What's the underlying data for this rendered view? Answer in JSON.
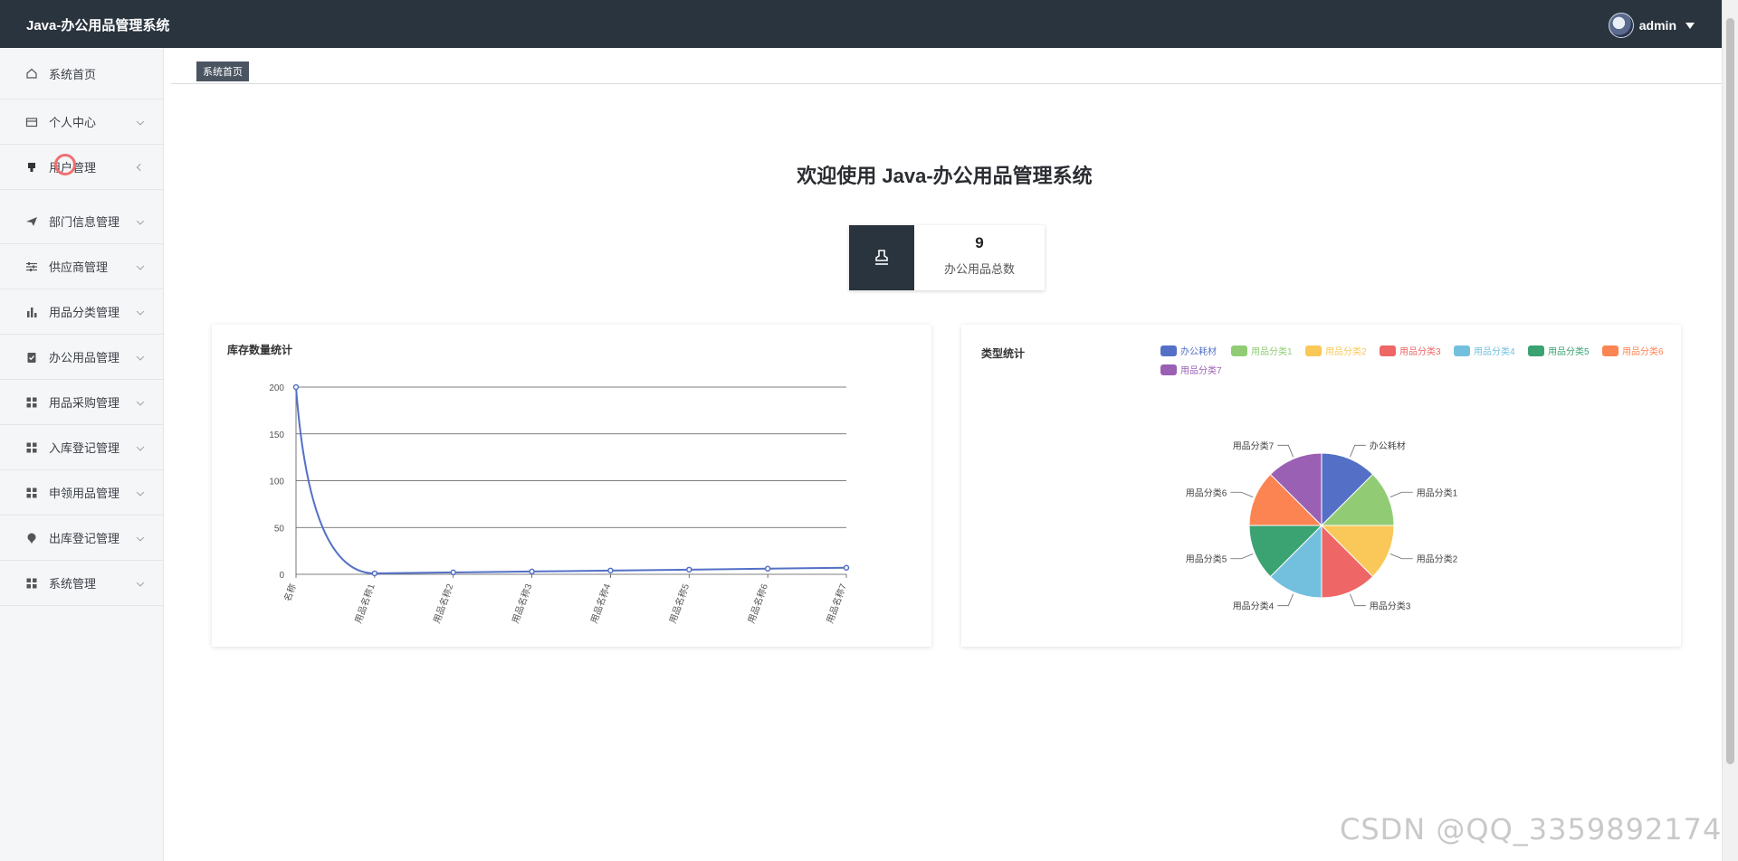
{
  "header": {
    "brand": "Java-办公用品管理系统",
    "username": "admin"
  },
  "sidebar": {
    "items": [
      {
        "label": "系统首页",
        "icon": "home-icon",
        "arrow": "none"
      },
      {
        "label": "个人中心",
        "icon": "card-icon",
        "arrow": "down"
      },
      {
        "label": "用户管理",
        "icon": "user-icon",
        "arrow": "left"
      },
      {
        "label": "部门信息管理",
        "icon": "send-icon",
        "arrow": "down"
      },
      {
        "label": "供应商管理",
        "icon": "sliders-icon",
        "arrow": "down"
      },
      {
        "label": "用品分类管理",
        "icon": "bar-chart-icon",
        "arrow": "down"
      },
      {
        "label": "办公用品管理",
        "icon": "clipboard-check-icon",
        "arrow": "down"
      },
      {
        "label": "用品采购管理",
        "icon": "grid-icon",
        "arrow": "down"
      },
      {
        "label": "入库登记管理",
        "icon": "grid-icon",
        "arrow": "down"
      },
      {
        "label": "申领用品管理",
        "icon": "grid-icon",
        "arrow": "down"
      },
      {
        "label": "出库登记管理",
        "icon": "pin-icon",
        "arrow": "down"
      },
      {
        "label": "系统管理",
        "icon": "grid-icon",
        "arrow": "down"
      }
    ]
  },
  "breadcrumb": "系统首页",
  "welcome": "欢迎使用 Java-办公用品管理系统",
  "stat": {
    "value": "9",
    "label": "办公用品总数",
    "icon": "stamp-icon"
  },
  "line_panel": {
    "title": "库存数量统计"
  },
  "pie_panel": {
    "title": "类型统计"
  },
  "watermark": "CSDN @QQ_3359892174",
  "chart_data": [
    {
      "type": "line",
      "title": "库存数量统计",
      "categories": [
        "名称",
        "用品名称1",
        "用品名称2",
        "用品名称3",
        "用品名称4",
        "用品名称5",
        "用品名称6",
        "用品名称7"
      ],
      "values": [
        200,
        1,
        2,
        3,
        4,
        5,
        6,
        7
      ],
      "ylim": [
        0,
        200
      ],
      "yticks": [
        "0",
        "50",
        "100",
        "150",
        "200"
      ],
      "smooth": true,
      "grid": "horizontal",
      "color": "#5470c6"
    },
    {
      "type": "pie",
      "title": "类型统计",
      "legend_position": "top-right",
      "categories": [
        "办公耗材",
        "用品分类1",
        "用品分类2",
        "用品分类3",
        "用品分类4",
        "用品分类5",
        "用品分类6",
        "用品分类7"
      ],
      "values": [
        1,
        1,
        1,
        1,
        1,
        1,
        1,
        1
      ],
      "colors": [
        "#5470c6",
        "#91cc75",
        "#fac858",
        "#ee6666",
        "#73c0de",
        "#3ba272",
        "#fc8452",
        "#9a60b4"
      ]
    }
  ]
}
